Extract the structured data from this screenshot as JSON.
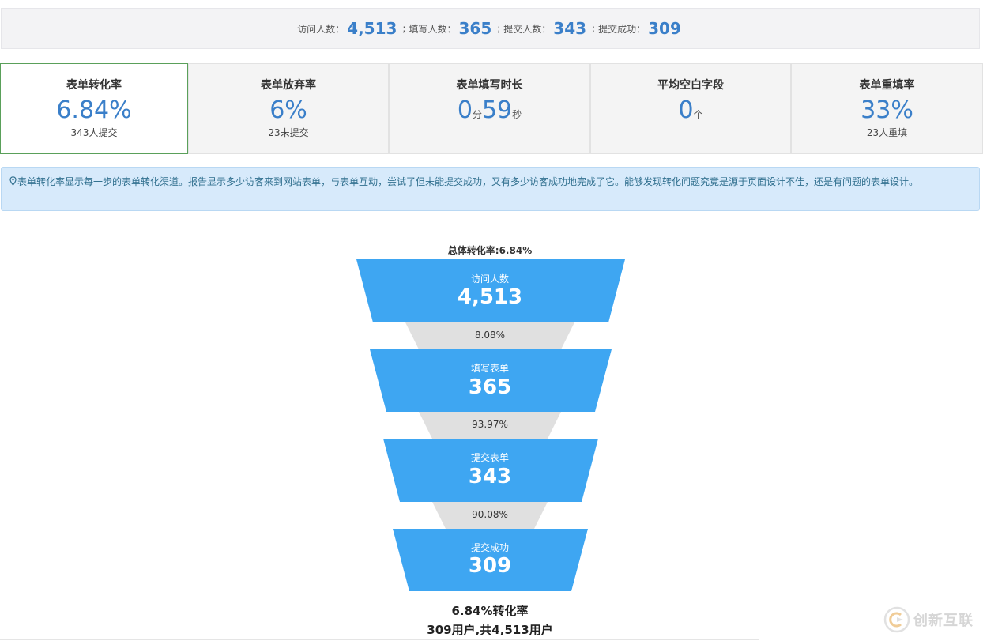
{
  "summary": {
    "visitors_label": "访问人数：",
    "visitors": "4,513",
    "fillers_label": "填写人数：",
    "fillers": "365",
    "submitters_label": "提交人数：",
    "submitters": "343",
    "success_label": "提交成功：",
    "success": "309",
    "separator": ";"
  },
  "kpis": [
    {
      "title": "表单转化率",
      "value": "6.84%",
      "sub": "343人提交"
    },
    {
      "title": "表单放弃率",
      "value": "6%",
      "sub": "23未提交"
    },
    {
      "title": "表单填写时长",
      "minutes": "0",
      "minutes_unit": "分",
      "seconds": "59",
      "seconds_unit": "秒"
    },
    {
      "title": "平均空白字段",
      "value": "0",
      "unit": "个"
    },
    {
      "title": "表单重填率",
      "value": "33%",
      "sub": "23人重填"
    }
  ],
  "info_text": "表单转化率显示每一步的表单转化渠道。报告显示多少访客来到网站表单，与表单互动，尝试了但未能提交成功，又有多少访客成功地完成了它。能够发现转化问题究竟是源于页面设计不佳，还是有问题的表单设计。",
  "funnel": {
    "overall_label": "总体转化率:6.84%",
    "stages": [
      {
        "label": "访问人数",
        "value": "4,513"
      },
      {
        "label": "填写表单",
        "value": "365"
      },
      {
        "label": "提交表单",
        "value": "343"
      },
      {
        "label": "提交成功",
        "value": "309"
      }
    ],
    "conversions": [
      "8.08%",
      "93.97%",
      "90.08%"
    ],
    "footer_rate": "6.84%转化率",
    "footer_users": "309用户,共4,513用户",
    "stage_color": "#3ea6f2",
    "gap_color": "#e0e0e0"
  },
  "watermark": {
    "text": "创新互联"
  }
}
